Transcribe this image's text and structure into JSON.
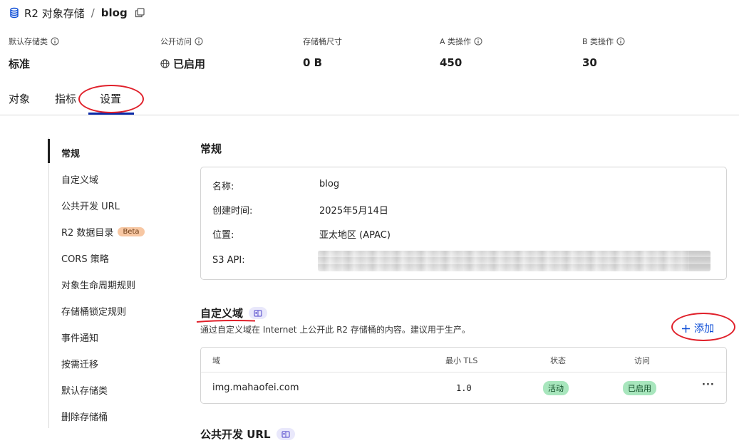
{
  "breadcrumb": {
    "root": "R2 对象存储",
    "separator": "/",
    "current": "blog"
  },
  "stats": [
    {
      "label": "默认存储类",
      "value": "标准",
      "info": true
    },
    {
      "label": "公开访问",
      "value": "已启用",
      "info": true,
      "icon": "globe-icon"
    },
    {
      "label": "存储桶尺寸",
      "value": "0 B",
      "info": false
    },
    {
      "label": "A 类操作",
      "value": "450",
      "info": true
    },
    {
      "label": "B 类操作",
      "value": "30",
      "info": true
    }
  ],
  "tabs": [
    {
      "label": "对象"
    },
    {
      "label": "指标"
    },
    {
      "label": "设置",
      "active": true
    }
  ],
  "sidenav": {
    "items": [
      {
        "label": "常规",
        "active": true
      },
      {
        "label": "自定义域"
      },
      {
        "label": "公共开发 URL"
      },
      {
        "label": "R2 数据目录",
        "badge": "Beta"
      },
      {
        "label": "CORS 策略"
      },
      {
        "label": "对象生命周期规则"
      },
      {
        "label": "存储桶锁定规则"
      },
      {
        "label": "事件通知"
      },
      {
        "label": "按需迁移"
      },
      {
        "label": "默认存储类"
      },
      {
        "label": "删除存储桶"
      }
    ]
  },
  "general": {
    "title": "常规",
    "fields": [
      {
        "label": "名称:",
        "value": "blog"
      },
      {
        "label": "创建时间:",
        "value": "2025年5月14日"
      },
      {
        "label": "位置:",
        "value": "亚太地区 (APAC)"
      },
      {
        "label": "S3 API:",
        "value": ""
      }
    ]
  },
  "custom_domains": {
    "title": "自定义域",
    "description": "通过自定义域在 Internet 上公开此 R2 存储桶的内容。建议用于生产。",
    "add_label": "添加",
    "columns": [
      "域",
      "最小 TLS",
      "状态",
      "访问"
    ],
    "rows": [
      {
        "domain": "img.mahaofei.com",
        "min_tls": "1.0",
        "status": "活动",
        "access": "已启用"
      }
    ],
    "more_label": "···"
  },
  "public_dev_url": {
    "title": "公共开发 URL"
  },
  "colors": {
    "accent": "#0a4bd6",
    "tab_underline": "#0a2aa8",
    "status_green": "#a8e6bd",
    "annotation_red": "#e0202a",
    "beta_badge": "#f7c7a3"
  }
}
